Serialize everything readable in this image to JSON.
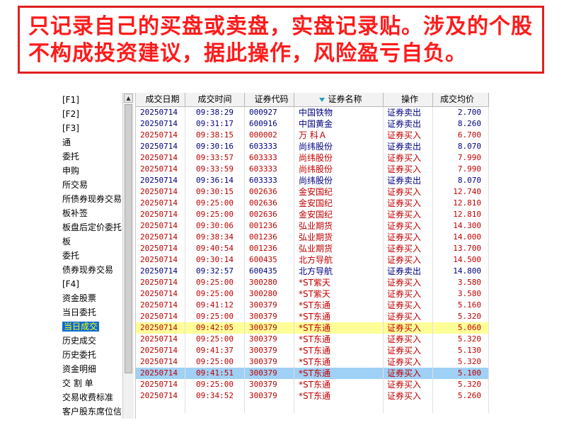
{
  "banner": {
    "text": "只记录自己的买盘或卖盘，实盘记录贴。涉及的个股不构成投资建议，据此操作，风险盈亏自负。"
  },
  "sidebar": {
    "items": [
      {
        "label": "[F1]",
        "selected": false
      },
      {
        "label": "[F2]",
        "selected": false
      },
      {
        "label": "[F3]",
        "selected": false
      },
      {
        "label": "通",
        "selected": false
      },
      {
        "label": "委托",
        "selected": false
      },
      {
        "label": "申购",
        "selected": false
      },
      {
        "label": "所交易",
        "selected": false
      },
      {
        "label": "所债券现券交易",
        "selected": false
      },
      {
        "label": "板补签",
        "selected": false
      },
      {
        "label": "板盘后定价委托",
        "selected": false
      },
      {
        "label": "板",
        "selected": false
      },
      {
        "label": "委托",
        "selected": false
      },
      {
        "label": "债券现券交易",
        "selected": false
      },
      {
        "label": "[F4]",
        "selected": false
      },
      {
        "label": "资金股票",
        "selected": false
      },
      {
        "label": "当日委托",
        "selected": false
      },
      {
        "label": "当日成交",
        "selected": true
      },
      {
        "label": "历史成交",
        "selected": false
      },
      {
        "label": "历史委托",
        "selected": false
      },
      {
        "label": "资金明细",
        "selected": false
      },
      {
        "label": "交 割 单",
        "selected": false
      },
      {
        "label": "交易收费标准",
        "selected": false
      },
      {
        "label": "客户股东席位信息",
        "selected": false
      }
    ]
  },
  "table": {
    "headers": [
      "成交日期",
      "成交时间",
      "证券代码",
      "证券名称",
      "操作",
      "成交均价"
    ],
    "rows": [
      {
        "date": "20250714",
        "time": "09:38:29",
        "code": "000927",
        "name": "中国铁物",
        "op": "证券卖出",
        "price": "2.700",
        "side": "sell"
      },
      {
        "date": "20250714",
        "time": "09:31:17",
        "code": "600916",
        "name": "中国黄金",
        "op": "证券卖出",
        "price": "8.260",
        "side": "sell"
      },
      {
        "date": "20250714",
        "time": "09:38:15",
        "code": "000002",
        "name": "万 科Ａ",
        "op": "证券买入",
        "price": "6.700",
        "side": "buy"
      },
      {
        "date": "20250714",
        "time": "09:30:16",
        "code": "603333",
        "name": "尚纬股份",
        "op": "证券卖出",
        "price": "8.070",
        "side": "sell"
      },
      {
        "date": "20250714",
        "time": "09:33:57",
        "code": "603333",
        "name": "尚纬股份",
        "op": "证券买入",
        "price": "7.990",
        "side": "buy"
      },
      {
        "date": "20250714",
        "time": "09:33:59",
        "code": "603333",
        "name": "尚纬股份",
        "op": "证券买入",
        "price": "7.990",
        "side": "buy"
      },
      {
        "date": "20250714",
        "time": "09:36:14",
        "code": "603333",
        "name": "尚纬股份",
        "op": "证券卖出",
        "price": "8.070",
        "side": "sell"
      },
      {
        "date": "20250714",
        "time": "09:30:15",
        "code": "002636",
        "name": "金安国纪",
        "op": "证券买入",
        "price": "12.740",
        "side": "buy"
      },
      {
        "date": "20250714",
        "time": "09:25:00",
        "code": "002636",
        "name": "金安国纪",
        "op": "证券买入",
        "price": "12.810",
        "side": "buy"
      },
      {
        "date": "20250714",
        "time": "09:25:00",
        "code": "002636",
        "name": "金安国纪",
        "op": "证券买入",
        "price": "12.810",
        "side": "buy"
      },
      {
        "date": "20250714",
        "time": "09:30:06",
        "code": "001236",
        "name": "弘业期货",
        "op": "证券买入",
        "price": "14.300",
        "side": "buy"
      },
      {
        "date": "20250714",
        "time": "09:38:34",
        "code": "001236",
        "name": "弘业期货",
        "op": "证券买入",
        "price": "14.000",
        "side": "buy"
      },
      {
        "date": "20250714",
        "time": "09:40:54",
        "code": "001236",
        "name": "弘业期货",
        "op": "证券买入",
        "price": "13.700",
        "side": "buy"
      },
      {
        "date": "20250714",
        "time": "09:30:14",
        "code": "600435",
        "name": "北方导航",
        "op": "证券买入",
        "price": "14.500",
        "side": "buy"
      },
      {
        "date": "20250714",
        "time": "09:32:57",
        "code": "600435",
        "name": "北方导航",
        "op": "证券卖出",
        "price": "14.800",
        "side": "sell"
      },
      {
        "date": "20250714",
        "time": "09:25:00",
        "code": "300280",
        "name": "*ST紫天",
        "op": "证券买入",
        "price": "3.580",
        "side": "buy"
      },
      {
        "date": "20250714",
        "time": "09:25:00",
        "code": "300280",
        "name": "*ST紫天",
        "op": "证券买入",
        "price": "3.580",
        "side": "buy"
      },
      {
        "date": "20250714",
        "time": "09:41:12",
        "code": "300379",
        "name": "*ST东通",
        "op": "证券买入",
        "price": "5.160",
        "side": "buy"
      },
      {
        "date": "20250714",
        "time": "09:25:00",
        "code": "300379",
        "name": "*ST东通",
        "op": "证券买入",
        "price": "5.320",
        "side": "buy"
      },
      {
        "date": "20250714",
        "time": "09:42:05",
        "code": "300379",
        "name": "*ST东通",
        "op": "证券买入",
        "price": "5.060",
        "side": "buy",
        "highlight": "yellow"
      },
      {
        "date": "20250714",
        "time": "09:25:00",
        "code": "300379",
        "name": "*ST东通",
        "op": "证券买入",
        "price": "5.320",
        "side": "buy"
      },
      {
        "date": "20250714",
        "time": "09:41:37",
        "code": "300379",
        "name": "*ST东通",
        "op": "证券买入",
        "price": "5.130",
        "side": "buy"
      },
      {
        "date": "20250714",
        "time": "09:25:00",
        "code": "300379",
        "name": "*ST东通",
        "op": "证券买入",
        "price": "5.320",
        "side": "buy"
      },
      {
        "date": "20250714",
        "time": "09:41:51",
        "code": "300379",
        "name": "*ST东通",
        "op": "证券买入",
        "price": "5.100",
        "side": "buy",
        "highlight": "blue"
      },
      {
        "date": "20250714",
        "time": "09:25:00",
        "code": "300379",
        "name": "*ST东通",
        "op": "证券买入",
        "price": "5.320",
        "side": "buy"
      },
      {
        "date": "20250714",
        "time": "09:34:52",
        "code": "300379",
        "name": "*ST东通",
        "op": "证券买入",
        "price": "5.260",
        "side": "buy"
      }
    ]
  },
  "colors": {
    "banner_red": "#ff1a1a",
    "buy_text": "#c00000",
    "sell_text": "#000080",
    "selected_bg": "#0a6bd6",
    "selected_text": "#ffff00",
    "row_yellow": "#ffff99",
    "row_blue": "#9fd0f5"
  },
  "icons": {
    "sort": "triangle-down-icon",
    "scroll_up": "scroll-up-arrow-icon"
  }
}
